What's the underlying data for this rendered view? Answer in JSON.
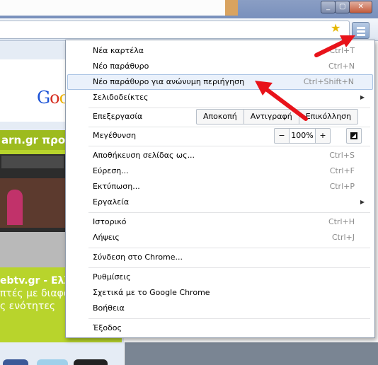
{
  "window_controls": {
    "minimize_glyph": "_",
    "restore_glyph": "▢",
    "close_glyph": "✕"
  },
  "toolbar": {
    "bookmark_star_glyph": "★",
    "menu_button_icon": "wrench-menu-icon"
  },
  "background_page": {
    "google_logo_partial": "Goo",
    "green_header": "arn.gr προτ",
    "green_text_lines": [
      "ebtv.gr - Ελλη",
      "πτές με διαφο",
      "ς ενότητες"
    ]
  },
  "menu": {
    "new_tab": {
      "label": "Νέα καρτέλα",
      "shortcut": "Ctrl+T"
    },
    "new_window": {
      "label": "Νέο παράθυρο",
      "shortcut": "Ctrl+N"
    },
    "new_incognito": {
      "label": "Νέο παράθυρο για ανώνυμη περιήγηση",
      "shortcut": "Ctrl+Shift+N"
    },
    "bookmarks": {
      "label": "Σελιδοδείκτες"
    },
    "edit": {
      "label": "Επεξεργασία",
      "cut": "Αποκοπή",
      "copy": "Αντιγραφή",
      "paste": "Επικόλληση"
    },
    "zoom": {
      "label": "Μεγέθυνση",
      "minus": "−",
      "value": "100%",
      "plus": "+"
    },
    "save_page": {
      "label": "Αποθήκευση σελίδας ως...",
      "shortcut": "Ctrl+S"
    },
    "find": {
      "label": "Εύρεση...",
      "shortcut": "Ctrl+F"
    },
    "print": {
      "label": "Εκτύπωση...",
      "shortcut": "Ctrl+P"
    },
    "tools": {
      "label": "Εργαλεία"
    },
    "history": {
      "label": "Ιστορικό",
      "shortcut": "Ctrl+H"
    },
    "downloads": {
      "label": "Λήψεις",
      "shortcut": "Ctrl+J"
    },
    "sign_in": {
      "label": "Σύνδεση στο Chrome..."
    },
    "settings": {
      "label": "Ρυθμίσεις"
    },
    "about": {
      "label": "Σχετικά με το Google Chrome"
    },
    "help": {
      "label": "Βοήθεια"
    },
    "exit": {
      "label": "Έξοδος"
    },
    "submenu_arrow": "▶"
  },
  "colors": {
    "annotation_arrow": "#e8131a",
    "menu_hover": "#eaf1fb",
    "green_panel": "#b8d42c"
  }
}
